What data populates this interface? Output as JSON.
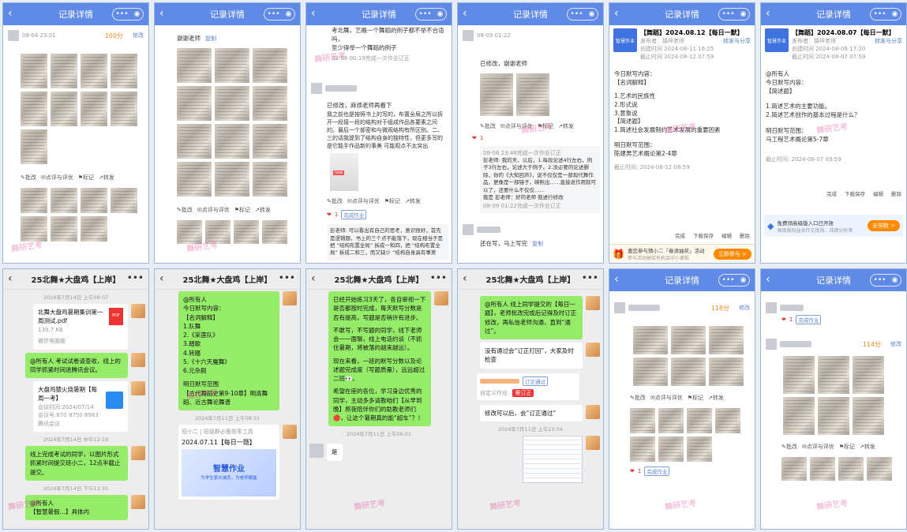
{
  "common": {
    "detail_title": "记录详情",
    "chat_title": "25北舞★大盘鸡【上岸】",
    "edit": "修改",
    "pizhu": "批改",
    "dianping": "点评与评优",
    "biaoji": "标记",
    "zhuanfa": "转发",
    "watermark": "舞研艺考"
  },
  "p1": {
    "time": "08-04 23:01",
    "score": "100分"
  },
  "p2": {
    "text": "谢谢老师",
    "copy": "复制"
  },
  "p3": {
    "lines": [
      "考北舞，艺概一个舞蹈的例子都不举不合适吗，",
      "至少得举一个舞蹈的例子"
    ],
    "note1": "08-08 00:19完成一次作业订正",
    "text2": "已修改，麻烦老师再看下",
    "text3": "我之前也是按照书上的写的，布置全局之所以拆开一段接一段的结构对于组成作品各要素之间的。最后一个部密和与微观结构有所区别。二、三的话我提到了结构自身的独特性，但更多写的是它能手作品新的事美 可能观点不太突出",
    "badge": "1",
    "done": "完成作业",
    "bottom": "彭老师: 可以看出有自己的思考，意识很好，首先是逻辑题，书上的三个点不能落下，现在相当于是把 “结构布置全局” 拆成一和四，把 “结构布置全局” 拆成二和三，而又缺少 “结构自身具有事美"
  },
  "p4": {
    "time": "08-09 01:22",
    "text1": "已修改，谢谢老师",
    "badge": "1",
    "note1": "08-08 23:46完成一次作业订正",
    "reply1": "彭老师: 我的天，以后，1.每段论述4行左右，例子3行左右，论述大于例子。2.没必要的论述删除，你的《大知回声》，说不仅仅是一部现代舞作品，更像是一部镜子，映照出……直接说作用就可以了，还要什么不仅仅……",
    "reply2": "我是 彭老师：好的老师 我进行修改",
    "note2": "08-09 01:22完成一次作业订正",
    "last": "还在写，马上写完",
    "copy": "复制"
  },
  "p5": {
    "title": "【舞蹈】2024.08.12【每日一默】",
    "creator": "发布者：镇祥老师",
    "created": "创建时间 2024-08-11 16:25",
    "deadline": "截止时间 2024-08-12 07:59",
    "share": "转发与分享",
    "logo": "智慧作业",
    "body": [
      "今日默写内容：",
      "【名词解释】",
      "1.艺术的民族性",
      "2.形式说",
      "3.意象说",
      "【简述题】",
      "1.简述社会发展制约艺术发展的重要因素",
      "明日默写范围：",
      "陈建男艺术概论第2-4章"
    ],
    "end": "截止时间: 2024-08-12 08:59",
    "tools": [
      "完成",
      "下载保存",
      "编辑",
      "删除"
    ],
    "ad": "邀您参与猜小二「春请抽奖」活动",
    "ad_sub": "参与活动抽奖有机会中小蛋糕",
    "ad_btn": "立即参与 >"
  },
  "p6": {
    "title": "【舞蹈】2024.08.07【每日一默】",
    "creator": "发布者：镇祥老师",
    "created": "创建时间 2024-08-06 17:20",
    "deadline": "截止时间 2024-08-07 07:59",
    "share": "转发与分享",
    "logo": "智慧作业",
    "body": [
      "@所有人",
      "今日默写内容：",
      "【简述题】",
      "1.简述艺术的主要功能。",
      "2.简述艺术创作的基本过程是什么？",
      "明日默写范围：",
      "马工程艺术概论第5-7章"
    ],
    "end": "截止时间: 2024-08-07 09:59",
    "tools": [
      "完成",
      "下载保存",
      "编辑",
      "删除"
    ],
    "ad": "免费领高级版入口已开放",
    "ad_sub": "高级版权益含作文批改、成绩分析等",
    "ad_btn": "去领取 >"
  },
  "p7": {
    "ts1": "2024年7月14日 上午08:07",
    "file": "北舞大盘鸡暑期集训第一周测试.pdf",
    "size": "139.7 KB",
    "pdf": "PDF",
    "app": "微信电脑版",
    "msg1": "@所有人 考试试卷请查收，线上的同学抓紧时间进腾讯会议。",
    "meet_title": "大盘鸡猿火烧暑期【每周一考】",
    "meet_time": "会议时间:2024/07/14",
    "meet_id": "会议号:870 8750 6983",
    "meet_app": "腾讯会议",
    "ts2": "2024年7月14日 中午12:19",
    "msg2": "线上完成考试的同学，以图片形式抓紧时间提交班小二，12点半截止提交。",
    "ts3": "2024年7月14日 下午13:35",
    "msg3": "@所有人",
    "msg4": "【智慧暑假…】具体内"
  },
  "p8": {
    "msg": [
      "@所有人",
      "今日默写内容：",
      "【名词解释】",
      "1.队舞",
      "2.《采莲队》",
      "3.踏歌",
      "4.转踏",
      "5.《十六天魔舞》",
      "6.元杂剧",
      "",
      "明日默写范围",
      "【古代舞蹈史第9-10章】明清舞蹈、近古舞论舞谱"
    ],
    "ts": "2024年7月11日 上午08:31",
    "card_src": "班小二 | 班级群必备效率工具",
    "card_title": "2024.07.11【每日一题】",
    "card_img": "智慧作业",
    "card_sub": "为学生家长减负，为老师赋能"
  },
  "p9": {
    "msg1": "已经开始练习3天了，各自审视一下是否都按时完成，每天默写分数是否有提高，写题是否稍许有进步。",
    "msg2": "不敢写，不写题的同学，线下老师会一一面聊，线上电话约谈（不抓住暑期，将被落的越来越远）。",
    "msg3": "现在来看，一班的默写分数以及论述题完成度（写题质量），远远超过二班👀。",
    "msg4": "希望在座的各位，学习身边优秀的同学，主动多多请教咱们【从早到晚】熬夜陪伴你们的助教老师们🔴，让这个暑期真的能“超车”？！",
    "ts": "2024年7月11日 上午06:01",
    "last": "是"
  },
  "p10": {
    "msg1": "@所有人 线上同学提交的【每日一题】，老师批改完成后记得及时订正修改，再私信老师沟通，直到“通过”。",
    "msg2": "没有通过会“订正打回”，大家及时检查",
    "tag": "订正通过",
    "self": "自定义作业:",
    "redo": "需订正",
    "msg3": "修改可以后，会“订正通过”",
    "ts": "2024年7月11日 上午23:04"
  },
  "p11": {
    "score": "118分",
    "badge": "1",
    "done": "完成作业"
  },
  "p12": {
    "score": "114分",
    "badge": "1",
    "done": "完成作业"
  }
}
